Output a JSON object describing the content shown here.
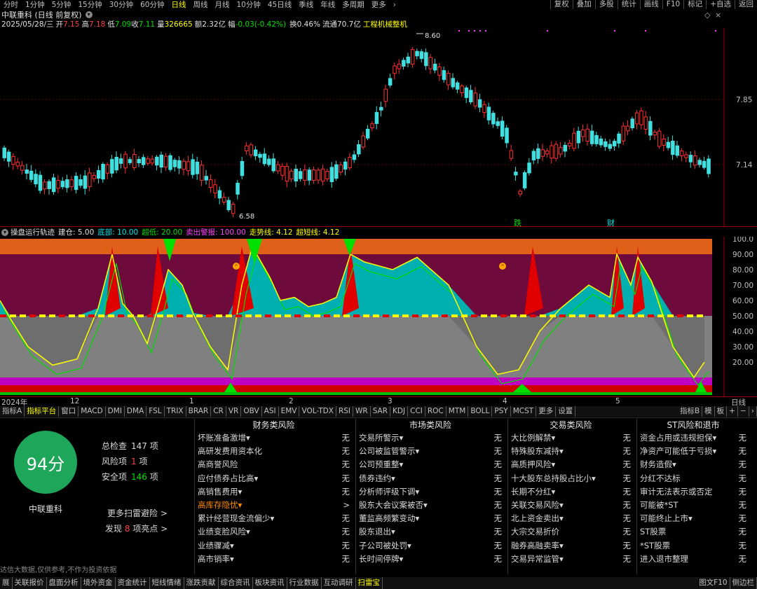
{
  "toolbar": {
    "timeframes": [
      "分时",
      "1分钟",
      "5分钟",
      "15分钟",
      "30分钟",
      "60分钟",
      "日线",
      "周线",
      "月线",
      "10分钟",
      "45日线",
      "季线",
      "年线",
      "多周期",
      "更多"
    ],
    "active_timeframe": "日线",
    "right_buttons": [
      "复权",
      "叠加",
      "多股",
      "统计",
      "画线",
      "F10",
      "标记",
      "+自选",
      "返回"
    ]
  },
  "stock": {
    "title": "中联重科 (日线 前复权)",
    "date": "2025/05/28/三",
    "open_label": "开",
    "open": "7.15",
    "high_label": "高",
    "high": "7.18",
    "low_label": "低",
    "low": "7.09",
    "close_label": "收",
    "close": "7.11",
    "volume_label": "量",
    "volume": "326665",
    "amount_label": "额",
    "amount": "2.32亿",
    "change_label": "幅",
    "change": "-0.03(-0.42%)",
    "turnover_label": "换",
    "turnover": "0.46%",
    "float_label": "流通",
    "float_cap": "70.7亿",
    "industry": "工程机械整机"
  },
  "price_chart": {
    "price_labels": [
      "7.85",
      "7.14"
    ],
    "high_marker": "8.60",
    "low_marker": "6.58",
    "markers": [
      "跌",
      "财"
    ]
  },
  "indicator": {
    "name": "操盘运行轨迹",
    "items": [
      {
        "label": "建仓: 5.00",
        "color": "#e0e0e0"
      },
      {
        "label": "底部: 10.00",
        "color": "#00e5e5"
      },
      {
        "label": "超低: 20.00",
        "color": "#00e000"
      },
      {
        "label": "卖出警报: 100.00",
        "color": "#ff40ff"
      },
      {
        "label": "走势线: 4.12",
        "color": "#ffff00"
      },
      {
        "label": "超短线: 4.12",
        "color": "#ffff00"
      }
    ],
    "y_labels": [
      "100.0",
      "90.00",
      "80.00",
      "70.00",
      "60.00",
      "50.00",
      "40.00",
      "30.00",
      "20.00"
    ]
  },
  "x_axis": {
    "labels": [
      "2024年",
      "12",
      "1",
      "2",
      "3",
      "4",
      "5"
    ],
    "right_label": "日线"
  },
  "indicator_tabs": {
    "items": [
      "指标A",
      "指标平台",
      "窗口",
      "MACD",
      "DMI",
      "DMA",
      "FSL",
      "TRIX",
      "BRAR",
      "CR",
      "VR",
      "OBV",
      "ASI",
      "EMV",
      "VOL-TDX",
      "RSI",
      "WR",
      "SAR",
      "KDJ",
      "CCI",
      "ROC",
      "MTM",
      "BOLL",
      "PSY",
      "MCST",
      "更多",
      "设置"
    ],
    "active": "指标平台",
    "right": [
      "指标B",
      "模",
      "板"
    ]
  },
  "scan": {
    "score": "94分",
    "stock_name": "中联重科",
    "total_label": "总检查",
    "total": "147",
    "total_unit": "项",
    "risk_label": "风险项",
    "risk": "1",
    "risk_unit": "项",
    "safe_label": "安全项",
    "safe": "146",
    "safe_unit": "项",
    "more_link": "更多扫雷避险 >",
    "find_prefix": "发现",
    "find_count": "8",
    "find_suffix": "项亮点 >",
    "disclaimer": "达信大数据,仅供参考,不作为投资依据"
  },
  "risk_columns": [
    {
      "title": "财务类风险",
      "rows": [
        {
          "k": "坏账准备激增▾",
          "v": "无"
        },
        {
          "k": "高研发费用资本化",
          "v": "无"
        },
        {
          "k": "高商誉风险",
          "v": "无"
        },
        {
          "k": "应付债券占比高▾",
          "v": "无"
        },
        {
          "k": "高销售费用▾",
          "v": "无"
        },
        {
          "k": "高库存隐忧▾",
          "v": ">",
          "hl": true
        },
        {
          "k": "累计经营现金流偏少▾",
          "v": "无"
        },
        {
          "k": "业绩变脸风险▾",
          "v": "无"
        },
        {
          "k": "业绩骤减▾",
          "v": "无"
        },
        {
          "k": "高市销率▾",
          "v": "无"
        }
      ]
    },
    {
      "title": "市场类风险",
      "rows": [
        {
          "k": "交易所警示▾",
          "v": "无"
        },
        {
          "k": "公司被监管警示▾",
          "v": "无"
        },
        {
          "k": "公司预重整▾",
          "v": "无"
        },
        {
          "k": "债券违约▾",
          "v": "无"
        },
        {
          "k": "分析师评级下调▾",
          "v": "无"
        },
        {
          "k": "股东大会议案被否▾",
          "v": "无"
        },
        {
          "k": "董监高频繁变动▾",
          "v": "无"
        },
        {
          "k": "股东退出▾",
          "v": "无"
        },
        {
          "k": "子公司被处罚▾",
          "v": "无"
        },
        {
          "k": "长时间停牌▾",
          "v": "无"
        }
      ]
    },
    {
      "title": "交易类风险",
      "rows": [
        {
          "k": "大比例解禁▾",
          "v": "无"
        },
        {
          "k": "特殊股东减持▾",
          "v": "无"
        },
        {
          "k": "高质押风险▾",
          "v": "无"
        },
        {
          "k": "十大股东总持股占比小▾",
          "v": "无"
        },
        {
          "k": "长期不分红▾",
          "v": "无"
        },
        {
          "k": "关联交易风险▾",
          "v": "无"
        },
        {
          "k": "北上资金卖出▾",
          "v": "无"
        },
        {
          "k": "大宗交易折价",
          "v": "无"
        },
        {
          "k": "融券高融卖率▾",
          "v": "无"
        },
        {
          "k": "交易异常监管▾",
          "v": "无"
        }
      ]
    },
    {
      "title": "ST风险和退市",
      "rows": [
        {
          "k": "资金占用或违规担保▾",
          "v": "无"
        },
        {
          "k": "净资产可能低于亏损▾",
          "v": "无"
        },
        {
          "k": "财务造假▾",
          "v": "无"
        },
        {
          "k": "分红不达标",
          "v": "无"
        },
        {
          "k": "审计无法表示或否定",
          "v": "无"
        },
        {
          "k": "可能被*ST",
          "v": "无"
        },
        {
          "k": "可能终止上市▾",
          "v": "无"
        },
        {
          "k": "ST股票",
          "v": "无"
        },
        {
          "k": "*ST股票",
          "v": "无"
        },
        {
          "k": "进入退市整理",
          "v": "无"
        }
      ]
    }
  ],
  "bottom_tabs": {
    "items": [
      "展",
      "关联报价",
      "盘面分析",
      "境外资金",
      "资金统计",
      "短线情绪",
      "涨跌贡献",
      "综合资讯",
      "板块资讯",
      "行业数据",
      "互动调研",
      "扫雷宝"
    ],
    "active": "扫雷宝",
    "right": [
      "图文F10",
      "侧边栏"
    ]
  }
}
